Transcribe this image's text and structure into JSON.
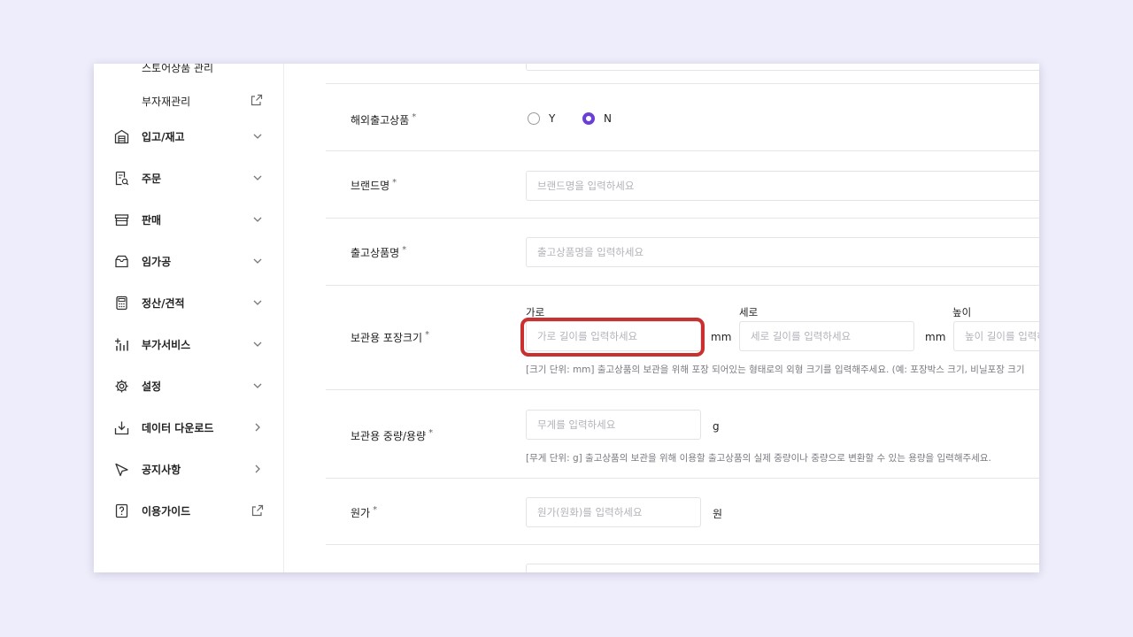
{
  "sidebar": {
    "sub_items": [
      {
        "label": "스토어상품 관리"
      },
      {
        "label": "부자재관리"
      }
    ],
    "items": [
      {
        "label": "입고/재고",
        "icon": "warehouse-icon",
        "arrow": "chevron-down-icon"
      },
      {
        "label": "주문",
        "icon": "order-document-icon",
        "arrow": "chevron-down-icon"
      },
      {
        "label": "판매",
        "icon": "store-icon",
        "arrow": "chevron-down-icon"
      },
      {
        "label": "임가공",
        "icon": "processing-box-icon",
        "arrow": "chevron-down-icon"
      },
      {
        "label": "정산/견적",
        "icon": "calculator-icon",
        "arrow": "chevron-down-icon"
      },
      {
        "label": "부가서비스",
        "icon": "add-service-icon",
        "arrow": "chevron-down-icon"
      },
      {
        "label": "설정",
        "icon": "gear-icon",
        "arrow": "chevron-down-icon"
      },
      {
        "label": "데이터 다운로드",
        "icon": "download-icon",
        "arrow": "chevron-right-icon"
      },
      {
        "label": "공지사항",
        "icon": "megaphone-icon",
        "arrow": "chevron-right-icon"
      },
      {
        "label": "이용가이드",
        "icon": "guide-icon",
        "arrow": "external-link-icon"
      }
    ]
  },
  "form": {
    "overseas": {
      "label": "해외출고상품",
      "required": "*",
      "options": [
        {
          "label": "Y",
          "checked": false
        },
        {
          "label": "N",
          "checked": true
        }
      ]
    },
    "brand": {
      "label": "브랜드명",
      "required": "*",
      "placeholder": "브랜드명을 입력하세요",
      "value": ""
    },
    "product_name": {
      "label": "출고상품명",
      "required": "*",
      "placeholder": "출고상품명을 입력하세요",
      "value": ""
    },
    "package_size": {
      "label": "보관용 포장크기",
      "required": "*",
      "width": {
        "label": "가로",
        "placeholder": "가로 길이를 입력하세요",
        "unit": "mm"
      },
      "depth": {
        "label": "세로",
        "placeholder": "세로 길이를 입력하세요",
        "unit": "mm"
      },
      "height": {
        "label": "높이",
        "placeholder": "높이 길이를 입력하세요"
      },
      "help": "[크기 단위: mm] 출고상품의 보관을 위해 포장 되어있는 형태로의 외형 크기를 입력해주세요. (예: 포장박스 크기, 비닐포장 크기"
    },
    "weight": {
      "label": "보관용 중량/용량",
      "required": "*",
      "placeholder": "무게를 입력하세요",
      "unit": "g",
      "help": "[무게 단위: g] 출고상품의 보관을 위해 이용할 출고상품의 실제 중량이나 중량으로 변환할 수 있는 용량을 입력해주세요."
    },
    "cost": {
      "label": "원가",
      "required": "*",
      "placeholder": "원가(원화)를 입력하세요",
      "unit": "원"
    }
  },
  "colors": {
    "accent": "#6a3fd6",
    "highlight": "#c9302f",
    "background": "#eeedfb"
  }
}
